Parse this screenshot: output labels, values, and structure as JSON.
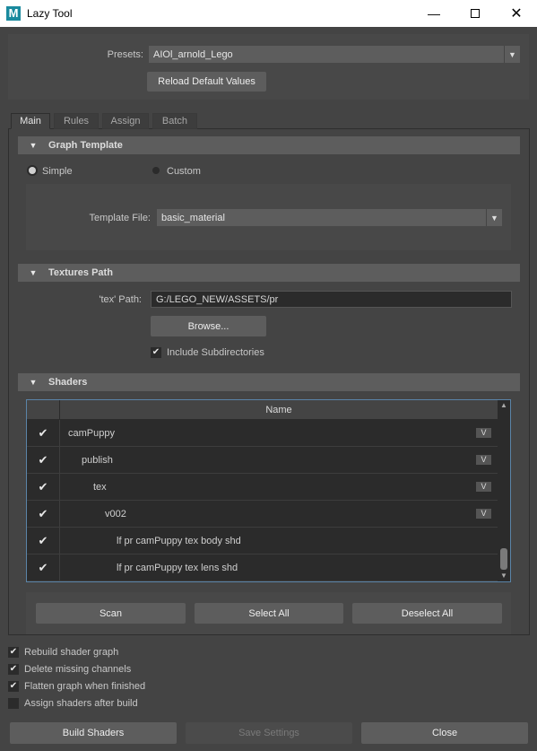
{
  "window": {
    "title": "Lazy Tool",
    "app_icon": "M"
  },
  "presets": {
    "label": "Presets:",
    "value": "AIOl_arnold_Lego",
    "reload_label": "Reload Default Values"
  },
  "tabs": [
    {
      "label": "Main",
      "active": true
    },
    {
      "label": "Rules",
      "active": false
    },
    {
      "label": "Assign",
      "active": false
    },
    {
      "label": "Batch",
      "active": false
    }
  ],
  "graph_template": {
    "header": "Graph Template",
    "simple_label": "Simple",
    "custom_label": "Custom",
    "selected": "Simple",
    "template_label": "Template File:",
    "template_value": "basic_material"
  },
  "textures_path": {
    "header": "Textures Path",
    "path_label": "'tex' Path:",
    "path_value": "G:/LEGO_NEW/ASSETS/pr",
    "browse_label": "Browse...",
    "include_subdirs_label": "Include Subdirectories",
    "include_subdirs_checked": true
  },
  "shaders": {
    "header": "Shaders",
    "column_name": "Name",
    "rows": [
      {
        "checked": true,
        "name": "camPuppy",
        "badge": "V"
      },
      {
        "checked": true,
        "name": "publish",
        "badge": "V"
      },
      {
        "checked": true,
        "name": "tex",
        "badge": "V"
      },
      {
        "checked": true,
        "name": "v002",
        "badge": "V"
      },
      {
        "checked": true,
        "name": "lf pr camPuppy tex body shd",
        "badge": ""
      },
      {
        "checked": true,
        "name": "lf pr camPuppy tex lens shd",
        "badge": ""
      }
    ],
    "scan_label": "Scan",
    "select_all_label": "Select All",
    "deselect_all_label": "Deselect All"
  },
  "options": [
    {
      "label": "Rebuild shader graph",
      "checked": true
    },
    {
      "label": "Delete missing channels",
      "checked": true
    },
    {
      "label": "Flatten graph when finished",
      "checked": true
    },
    {
      "label": "Assign shaders after build",
      "checked": false
    }
  ],
  "footer": {
    "build_label": "Build Shaders",
    "save_label": "Save Settings",
    "close_label": "Close"
  },
  "icons": {
    "check": "✔",
    "collapse": "▼",
    "dropdown": "▼"
  },
  "colors": {
    "bg": "#444444",
    "field": "#2b2b2b",
    "button": "#5d5d5d",
    "accent": "#1a8a9e"
  }
}
